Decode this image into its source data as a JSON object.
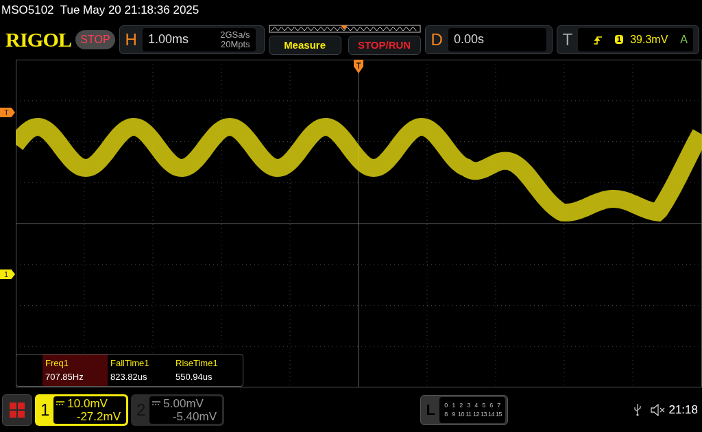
{
  "status_line": "MSO5102  Tue May 20 21:18:36 2025",
  "header": {
    "logo": "RIGOL",
    "run_state": "STOP",
    "horizontal": {
      "letter": "H",
      "timebase": "1.00ms",
      "sample_rate": "2GSa/s",
      "memory_depth": "20Mpts"
    },
    "buttons": [
      {
        "label": "Measure",
        "kind": "measure"
      },
      {
        "label": "STOP/RUN",
        "kind": "stoprun"
      }
    ],
    "delay": {
      "letter": "D",
      "value": "0.00s"
    },
    "trigger": {
      "letter": "T",
      "source": "1",
      "level": "39.3mV",
      "mode": "A"
    }
  },
  "markers": [
    {
      "label": "T",
      "kind": "trigger"
    },
    {
      "label": "1",
      "kind": "channel"
    }
  ],
  "measurements": [
    {
      "name": "Freq1",
      "value": "707.85Hz",
      "selected": true
    },
    {
      "name": "FallTime1",
      "value": "823.82us",
      "selected": false
    },
    {
      "name": "RiseTime1",
      "value": "550.94us",
      "selected": false
    }
  ],
  "channels": [
    {
      "number": "1",
      "scale": "10.0mV",
      "offset": "-27.2mV",
      "on": true
    },
    {
      "number": "2",
      "scale": "5.00mV",
      "offset": "-5.40mV",
      "on": false
    }
  ],
  "logic": {
    "letter": "L",
    "rows": [
      [
        "0",
        "1",
        "2",
        "3",
        "4",
        "5",
        "6",
        "7"
      ],
      [
        "8",
        "9",
        "10",
        "11",
        "12",
        "13",
        "14",
        "15"
      ]
    ]
  },
  "clock": "21:18"
}
